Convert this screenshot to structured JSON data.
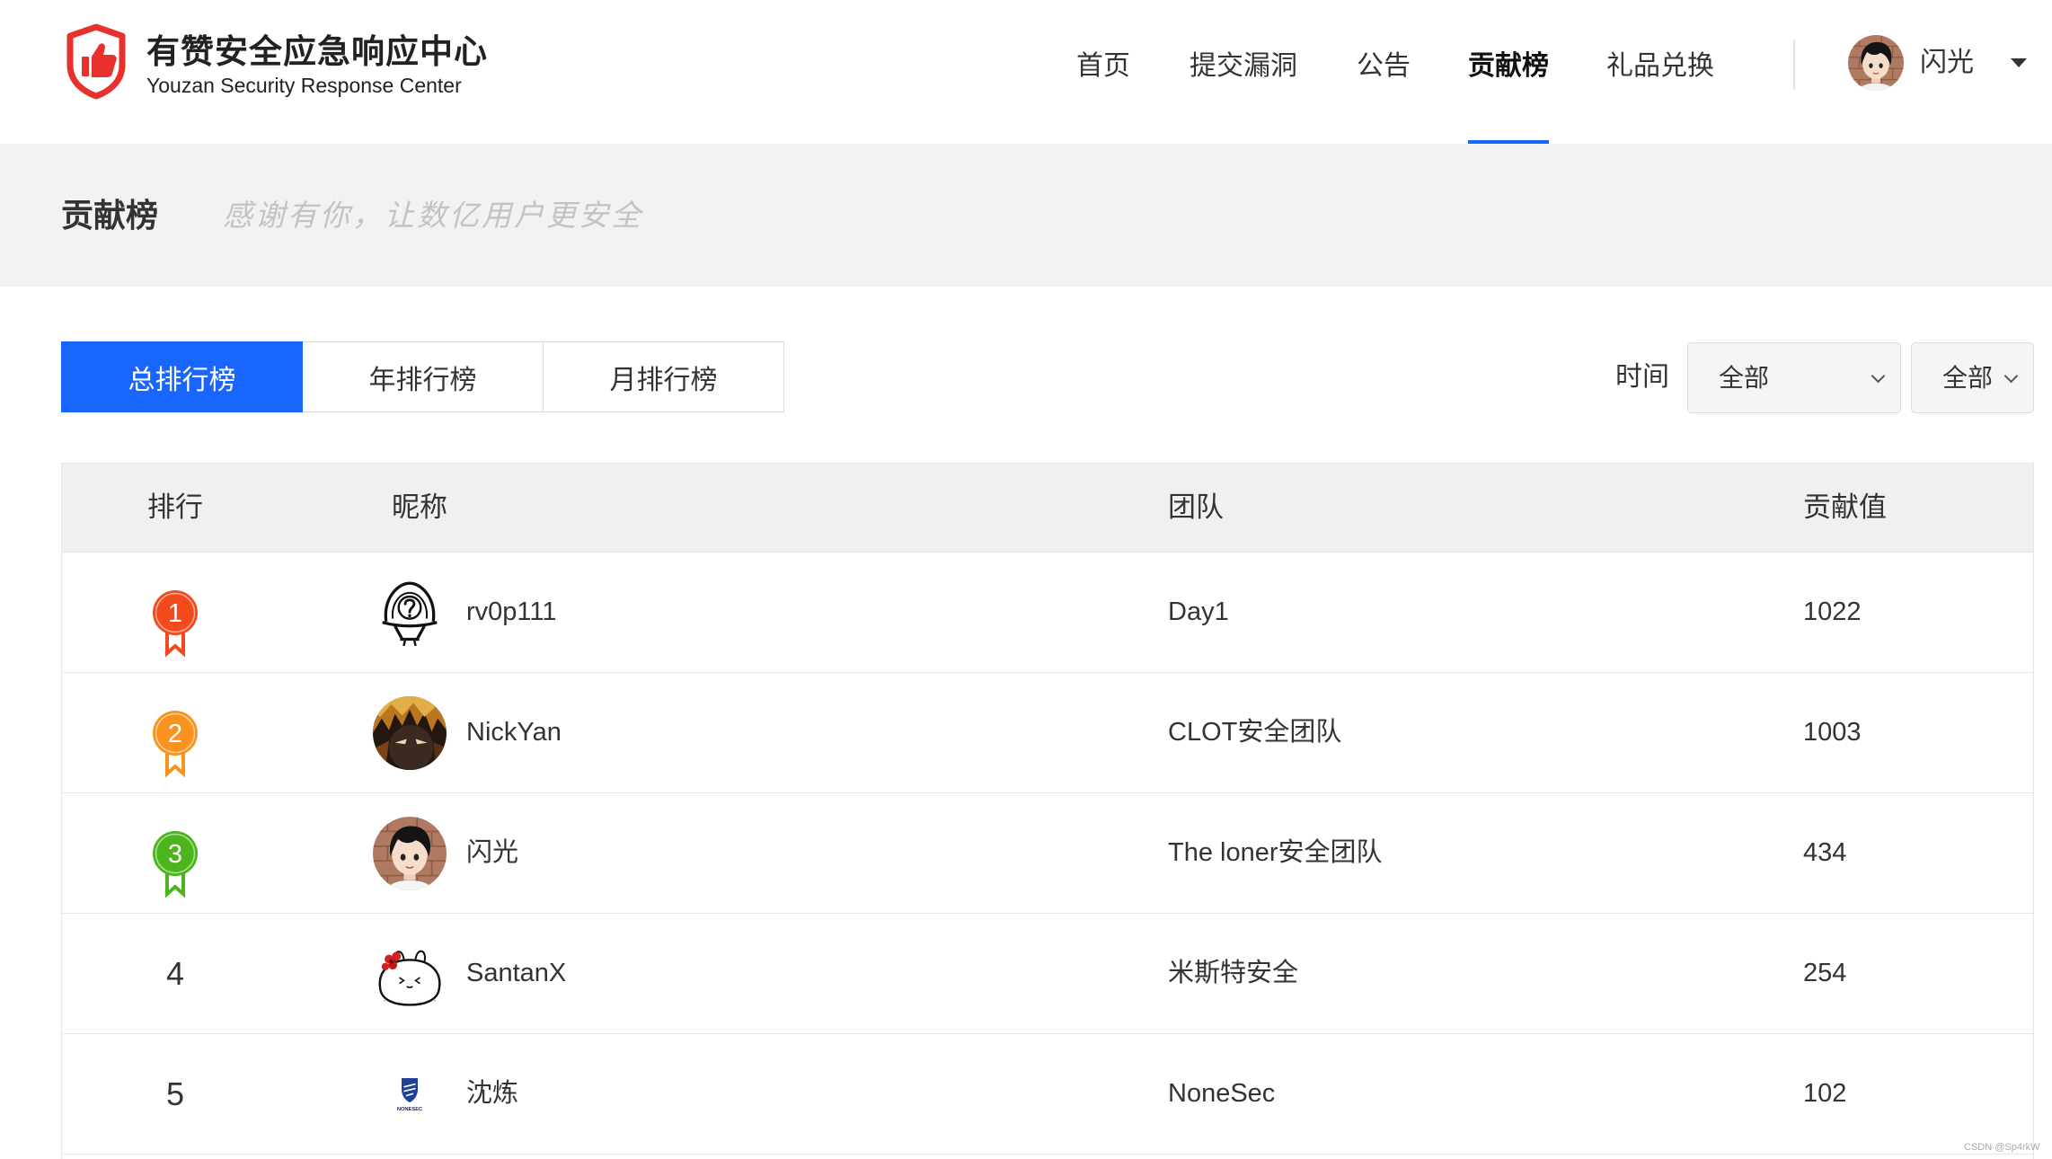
{
  "header": {
    "logo_icon": "shield-thumbs-up-icon",
    "title": "有赞安全应急响应中心",
    "subtitle": "Youzan Security Response Center",
    "nav": [
      {
        "label": "首页",
        "active": false
      },
      {
        "label": "提交漏洞",
        "active": false
      },
      {
        "label": "公告",
        "active": false
      },
      {
        "label": "贡献榜",
        "active": true
      },
      {
        "label": "礼品兑换",
        "active": false
      }
    ],
    "user": {
      "name": "闪光",
      "avatar_icon": "cartoon-boy-avatar",
      "menu_icon": "caret-down-icon"
    }
  },
  "banner": {
    "title": "贡献榜",
    "slogan": "感谢有你，让数亿用户更安全"
  },
  "tabs": [
    {
      "label": "总排行榜",
      "active": true
    },
    {
      "label": "年排行榜",
      "active": false
    },
    {
      "label": "月排行榜",
      "active": false
    }
  ],
  "filters": {
    "label": "时间",
    "selects": [
      {
        "value": "全部",
        "icon": "chevron-down-icon"
      },
      {
        "value": "全部",
        "icon": "chevron-down-icon"
      }
    ]
  },
  "table": {
    "columns": {
      "rank": "排行",
      "nickname": "昵称",
      "team": "团队",
      "score": "贡献值"
    },
    "rows": [
      {
        "rank": 1,
        "medal_color": "#f24a1d",
        "nickname": "rv0p111",
        "avatar_icon": "line-art-question-avatar",
        "team": "Day1",
        "score": 1022
      },
      {
        "rank": 2,
        "medal_color": "#f8931f",
        "nickname": "NickYan",
        "avatar_icon": "anime-character-avatar",
        "team": "CLOT安全团队",
        "score": 1003
      },
      {
        "rank": 3,
        "medal_color": "#4db51c",
        "nickname": "闪光",
        "avatar_icon": "cartoon-boy-avatar",
        "team": "The loner安全团队",
        "score": 434
      },
      {
        "rank": 4,
        "nickname": "SantanX",
        "avatar_icon": "mochi-flower-avatar",
        "team": "米斯特安全",
        "score": 254
      },
      {
        "rank": 5,
        "nickname": "沈炼",
        "avatar_icon": "nonesec-shield-avatar",
        "avatar_logo_text": "NONESEC",
        "team": "NoneSec",
        "score": 102
      }
    ]
  },
  "colors": {
    "accent": "#1966ff",
    "brand_red": "#e8302c",
    "banner_bg": "#f2f2f2",
    "table_header_bg": "#f0f0f0",
    "text": "#333333"
  },
  "watermark": "CSDN @Sp4rkW"
}
